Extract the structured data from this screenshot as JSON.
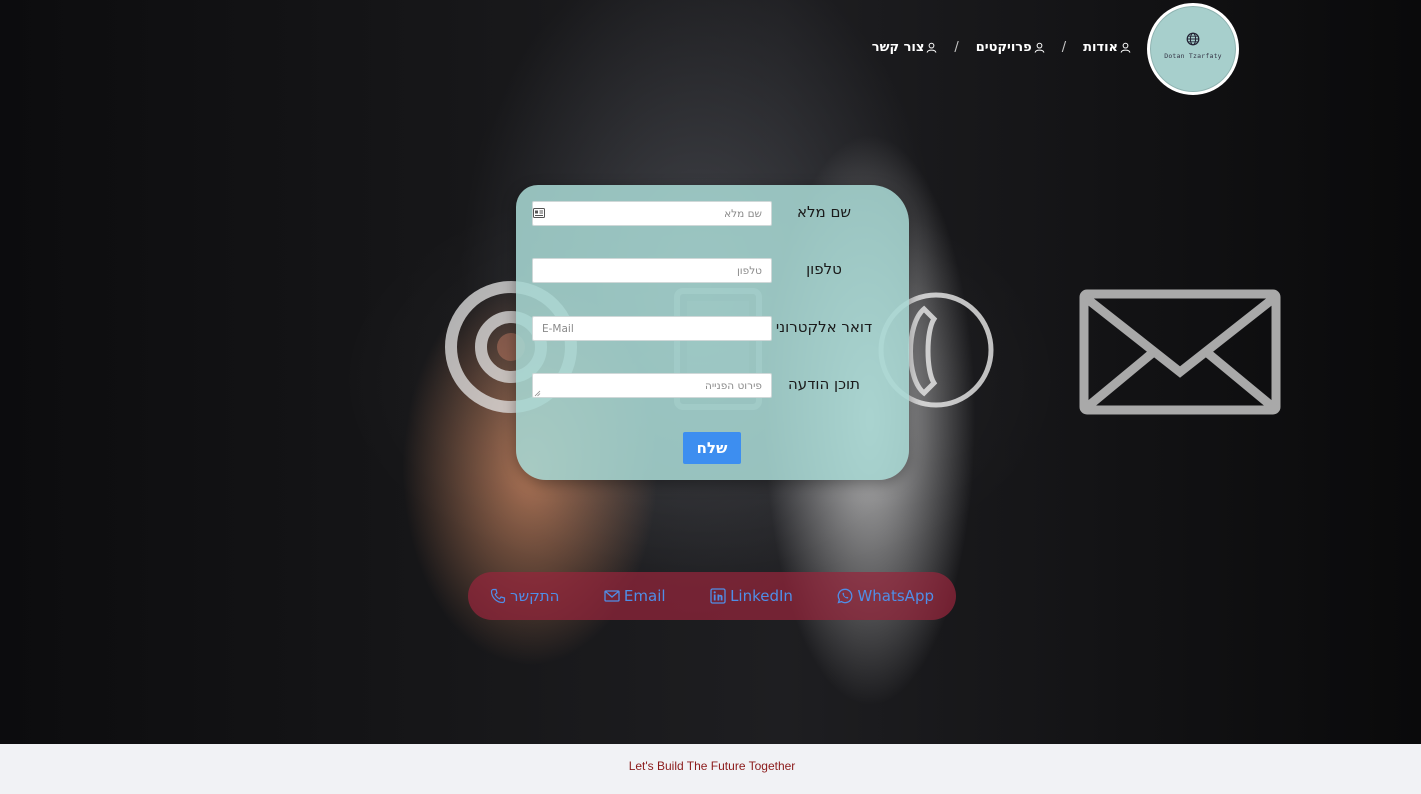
{
  "nav": {
    "items": [
      {
        "label": "אודות"
      },
      {
        "label": "פרויקטים"
      },
      {
        "label": "צור קשר"
      }
    ],
    "separator": "/"
  },
  "logo": {
    "text": "Dotan Tzarfaty",
    "icon": "globe-icon"
  },
  "form": {
    "full_name": {
      "label": "שם מלא",
      "placeholder": "שם מלא",
      "value": ""
    },
    "phone": {
      "label": "טלפון",
      "placeholder": "טלפון",
      "value": ""
    },
    "email": {
      "label": "דואר אלקטרוני",
      "placeholder": "E-Mail",
      "value": ""
    },
    "message": {
      "label": "תוכן הודעה",
      "placeholder": "פירוט הפנייה",
      "value": ""
    },
    "submit_label": "שלח"
  },
  "contact_bar": {
    "links": [
      {
        "label": "התקשר",
        "icon": "phone-icon"
      },
      {
        "label": "Email",
        "icon": "envelope-icon"
      },
      {
        "label": "LinkedIn",
        "icon": "linkedin-icon"
      },
      {
        "label": "WhatsApp",
        "icon": "whatsapp-icon"
      }
    ]
  },
  "footer": {
    "text": "Let's Build The Future Together"
  },
  "colors": {
    "form_panel": "#a6d6d2",
    "submit_button": "#3d8ef0",
    "contact_bar": "#96263c",
    "contact_link": "#4f8ee8",
    "footer_text": "#8b1a1a",
    "footer_bg": "#f1f2f5"
  }
}
